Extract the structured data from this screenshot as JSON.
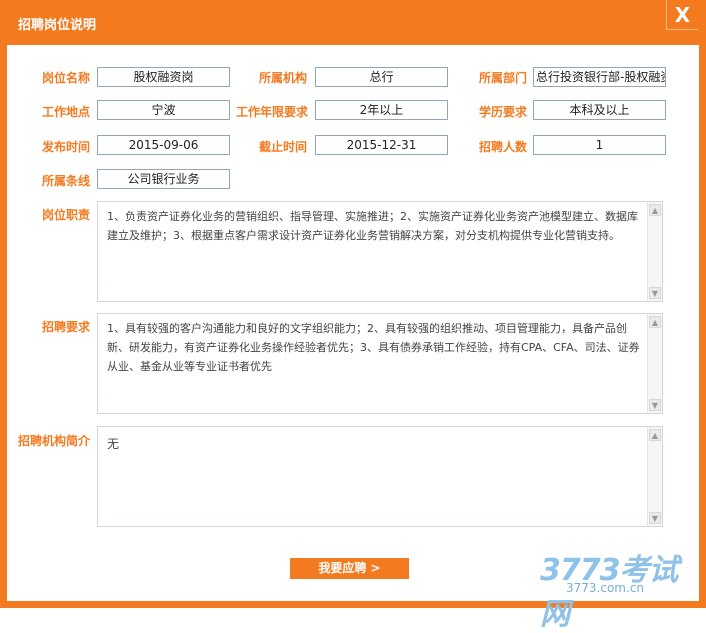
{
  "dialog": {
    "title": "招聘岗位说明",
    "close_label": "X"
  },
  "fields": {
    "position_name": {
      "label": "岗位名称",
      "value": "股权融资岗"
    },
    "organization": {
      "label": "所属机构",
      "value": "总行"
    },
    "department": {
      "label": "所属部门",
      "value": "总行投资银行部-股权融资"
    },
    "work_location": {
      "label": "工作地点",
      "value": "宁波"
    },
    "experience": {
      "label": "工作年限要求",
      "value": "2年以上"
    },
    "education": {
      "label": "学历要求",
      "value": "本科及以上"
    },
    "publish_date": {
      "label": "发布时间",
      "value": "2015-09-06"
    },
    "deadline": {
      "label": "截止时间",
      "value": "2015-12-31"
    },
    "headcount": {
      "label": "招聘人数",
      "value": "1"
    },
    "business_line": {
      "label": "所属条线",
      "value": "公司银行业务"
    }
  },
  "duties": {
    "label": "岗位职责",
    "text": "1、负责资产证券化业务的营销组织、指导管理、实施推进；2、实施资产证券化业务资产池模型建立、数据库建立及维护；3、根据重点客户需求设计资产证券化业务营销解决方案，对分支机构提供专业化营销支持。"
  },
  "requirements": {
    "label": "招聘要求",
    "text": "1、具有较强的客户沟通能力和良好的文字组织能力；2、具有较强的组织推动、项目管理能力，具备产品创新、研发能力，有资产证券化业务操作经验者优先；3、具有债券承销工作经验，持有CPA、CFA、司法、证券从业、基金从业等专业证书者优先"
  },
  "org_intro": {
    "label": "招聘机构简介",
    "text": "无"
  },
  "apply_button": {
    "label": "我要应聘 >"
  },
  "watermark": {
    "main": "3773考试网",
    "sub": "3773.com.cn"
  },
  "colors": {
    "accent": "#f47a20",
    "field_border": "#8fa6bd"
  }
}
